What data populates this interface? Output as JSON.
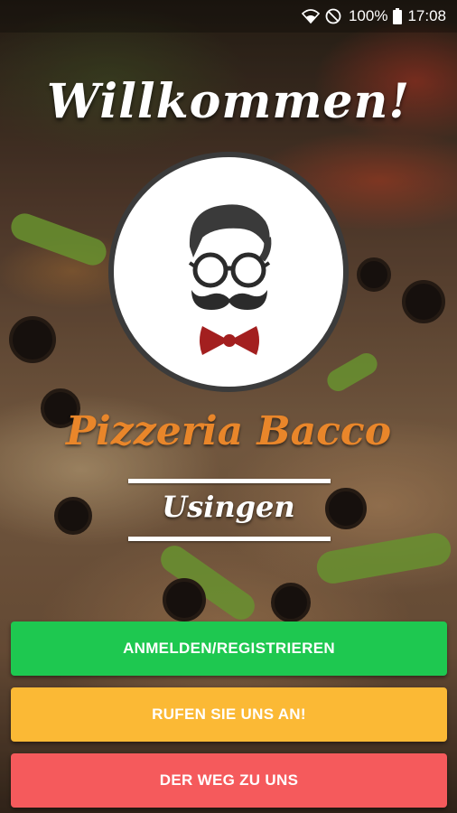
{
  "status_bar": {
    "battery": "100%",
    "time": "17:08",
    "icons": [
      "wifi-icon",
      "do-not-disturb-icon",
      "battery-icon"
    ]
  },
  "header": {
    "welcome": "Willkommen!"
  },
  "logo": {
    "icon": "mustache-man-icon"
  },
  "brand": {
    "name": "Pizzeria Bacco",
    "city": "Usingen"
  },
  "buttons": {
    "login": "ANMELDEN/REGISTRIEREN",
    "call": "RUFEN SIE UNS AN!",
    "directions": "DER WEG ZU UNS"
  },
  "colors": {
    "login": "#1ec850",
    "call": "#fbb935",
    "directions": "#f55a5c",
    "brand": "#e9862a"
  }
}
